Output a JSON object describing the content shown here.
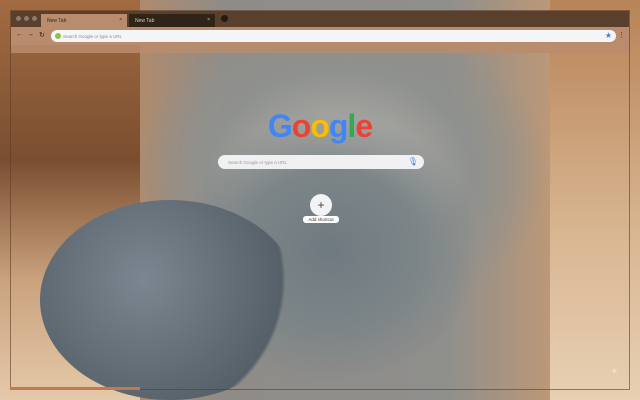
{
  "tabs": [
    {
      "label": "New Tab",
      "active": true
    },
    {
      "label": "New Tab",
      "active": false
    }
  ],
  "omnibox": {
    "placeholder": "Search Google or type a URL"
  },
  "ntp": {
    "logo": [
      "G",
      "o",
      "o",
      "g",
      "l",
      "e"
    ],
    "logo_colors": [
      "#4285f4",
      "#ea4335",
      "#fbbc05",
      "#4285f4",
      "#34a853",
      "#ea4335"
    ],
    "search_placeholder": "Search Google or type a URL",
    "add_shortcut_label": "Add shortcut"
  },
  "theme": {
    "frame": "#5a3f2c",
    "toolbar": "#b88c6c"
  }
}
